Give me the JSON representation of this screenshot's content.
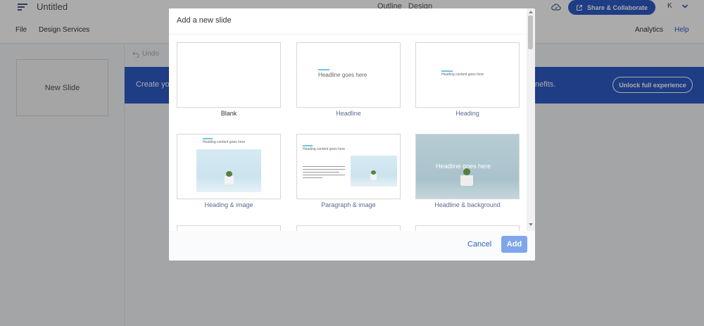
{
  "header": {
    "doc_title": "Untitled",
    "tab_outline": "Outline",
    "tab_design": "Design",
    "share_label": "Share & Collaborate",
    "avatar_initial": "K"
  },
  "menubar": {
    "file": "File",
    "design_services": "Design Services",
    "analytics": "Analytics",
    "help": "Help"
  },
  "sidebar": {
    "new_slide": "New Slide"
  },
  "toolbar": {
    "undo": "Undo"
  },
  "banner": {
    "text_left": "Create yo",
    "text_right": "nefits.",
    "unlock_label": "Unlock full experience"
  },
  "modal": {
    "title": "Add a new slide",
    "cancel": "Cancel",
    "add": "Add",
    "templates": [
      {
        "label": "Blank",
        "selected": true
      },
      {
        "label": "Headline",
        "thumb_text": "Headline goes here"
      },
      {
        "label": "Heading",
        "thumb_text": "Heading content goes here"
      },
      {
        "label": "Heading & image",
        "thumb_text": "Heading content goes here"
      },
      {
        "label": "Paragraph & image",
        "thumb_text": "Heading content goes here"
      },
      {
        "label": "Headline & background",
        "thumb_text": "Headline goes here"
      }
    ]
  },
  "colors": {
    "brand": "#2f5bc7",
    "accent_line": "#69c7e3",
    "add_button": "#7fa6ea"
  }
}
